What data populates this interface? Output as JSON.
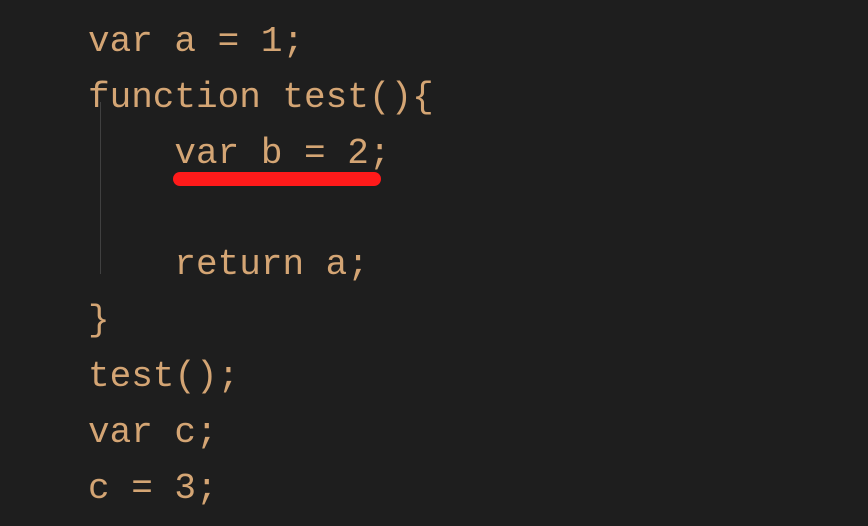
{
  "code": {
    "line1": {
      "kw_var": "var",
      "id_a": " a ",
      "op_eq": "=",
      "num_1": " 1",
      "semi": ";"
    },
    "line2": {
      "kw_function": "function",
      "id_test": " test",
      "parens": "()",
      "brace_open": "{"
    },
    "line3": {
      "indent": "    ",
      "kw_var": "var",
      "id_b": " b ",
      "op_eq": "=",
      "num_2": " 2",
      "semi": ";"
    },
    "line4": {
      "indent": "    ",
      "kw_return": "return",
      "id_a": " a",
      "semi": ";"
    },
    "line5": {
      "brace_close": "}"
    },
    "line6": {
      "id_test": "test",
      "parens": "()",
      "semi": ";"
    },
    "line7": {
      "kw_var": "var",
      "id_c": " c",
      "semi": ";"
    },
    "line8": {
      "id_c": "c ",
      "op_eq": "=",
      "num_3": " 3",
      "semi": ";"
    }
  },
  "annotation": {
    "type": "red-underline",
    "target_line": 3
  }
}
